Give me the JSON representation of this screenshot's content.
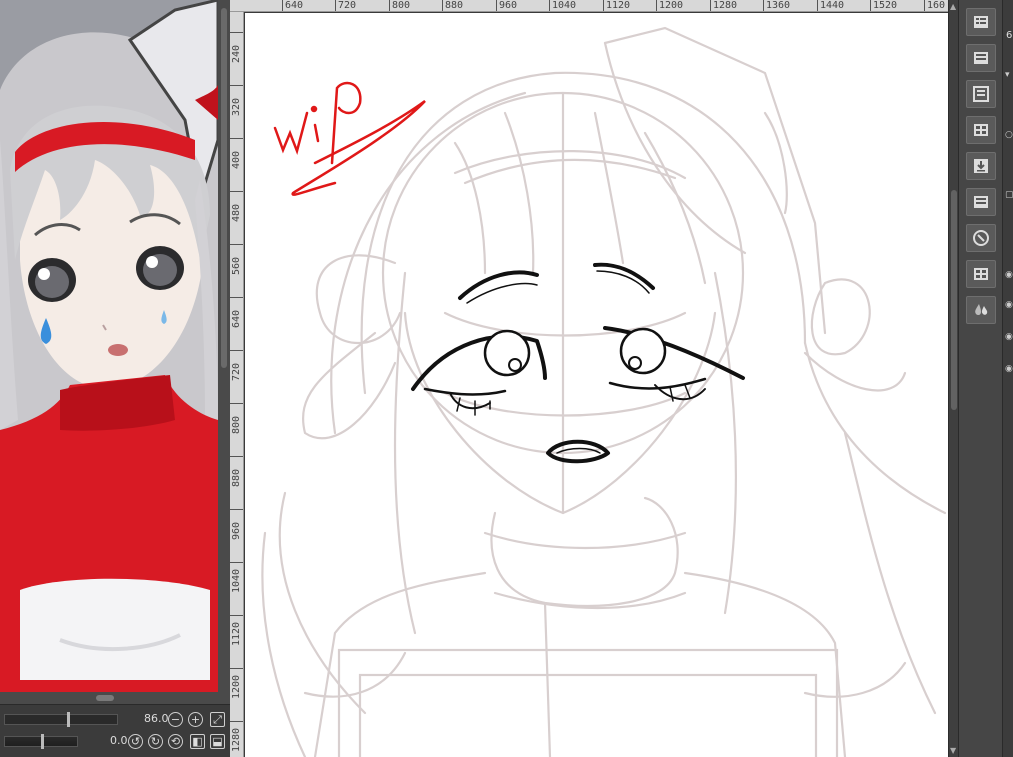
{
  "ruler": {
    "top_ticks": [
      "640",
      "720",
      "800",
      "880",
      "960",
      "1040",
      "1120",
      "1200",
      "1280",
      "1360",
      "1440",
      "1520",
      "160"
    ],
    "left_ticks": [
      "240",
      "320",
      "400",
      "480",
      "560",
      "640",
      "720",
      "800",
      "880",
      "960",
      "1040",
      "1120",
      "1200",
      "1280"
    ]
  },
  "canvas": {
    "wip_text": "wip"
  },
  "navigator": {
    "zoom_value": "86.0",
    "rotation_value": "0.0"
  },
  "right_edge": {
    "partial_value": "6"
  },
  "colors": {
    "ui_dark": "#3a3a3a",
    "canvas_bg": "#ffffff",
    "sketch_line": "#d6cccc",
    "wip_red": "#e01818",
    "ref_red": "#d81a24"
  },
  "tool_icons": [
    "layer-panel-icon",
    "layer-folder-icon",
    "properties-icon",
    "layer-grid-icon",
    "import-icon",
    "layer-list-icon",
    "navigator-icon",
    "color-set-icon",
    "color-drop-icon"
  ]
}
